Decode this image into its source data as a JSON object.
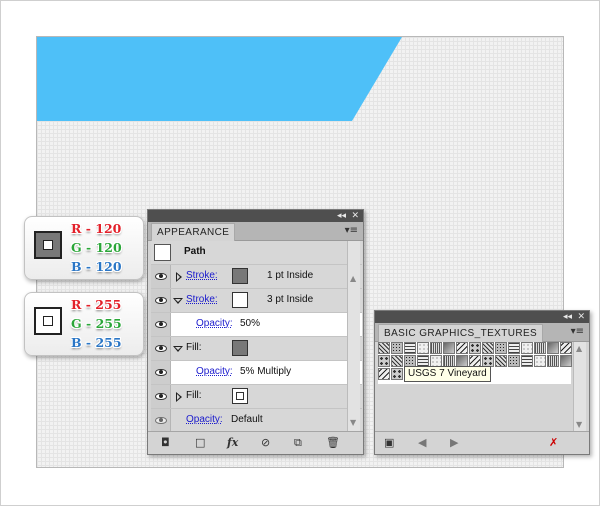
{
  "colors": {
    "blue_shape": "#4ec0f8",
    "fill_gray": "#787878",
    "red": "#e3202a",
    "green": "#2aa638",
    "blue": "#2a76c6",
    "link_blue": "#1a1acd"
  },
  "swatch_cards": [
    {
      "box_color": "#787878",
      "r": {
        "label": "R - 120"
      },
      "g": {
        "label": "G - 120"
      },
      "b": {
        "label": "B - 120"
      }
    },
    {
      "box_color": "#ffffff",
      "r": {
        "label": "R - 255"
      },
      "g": {
        "label": "G - 255"
      },
      "b": {
        "label": "B - 255"
      }
    }
  ],
  "appearance_panel": {
    "tab_label": "APPEARANCE",
    "collapse_icon": "double-left-arrow",
    "close_icon": "x",
    "menu_icon": "panel-menu",
    "header_label": "Path",
    "rows": {
      "stroke1": {
        "label": "Stroke:",
        "value": "1 pt  Inside"
      },
      "stroke2": {
        "label": "Stroke:",
        "value": "3 pt  Inside"
      },
      "opacity1": {
        "label": "Opacity:",
        "value": "50%"
      },
      "fill1": {
        "label": "Fill:"
      },
      "opacity2": {
        "label": "Opacity:",
        "value": "5% Multiply"
      },
      "fill2": {
        "label": "Fill:"
      },
      "opacity3": {
        "label": "Opacity:",
        "value": "Default"
      }
    },
    "footer_icons": [
      "stroke-swatch-icon",
      "fill-swatch-icon",
      "fx-icon",
      "clear-appearance-icon",
      "duplicate-item-icon",
      "trash-icon"
    ],
    "fx_label": "fx"
  },
  "textures_panel": {
    "tab_label": "BASIC GRAPHICS_TEXTURES",
    "tooltip": "USGS 7 Vineyard",
    "footer_icons": [
      "library-menu-icon",
      "previous-arrow-icon",
      "next-arrow-icon",
      "delete-swatch-icon"
    ]
  }
}
